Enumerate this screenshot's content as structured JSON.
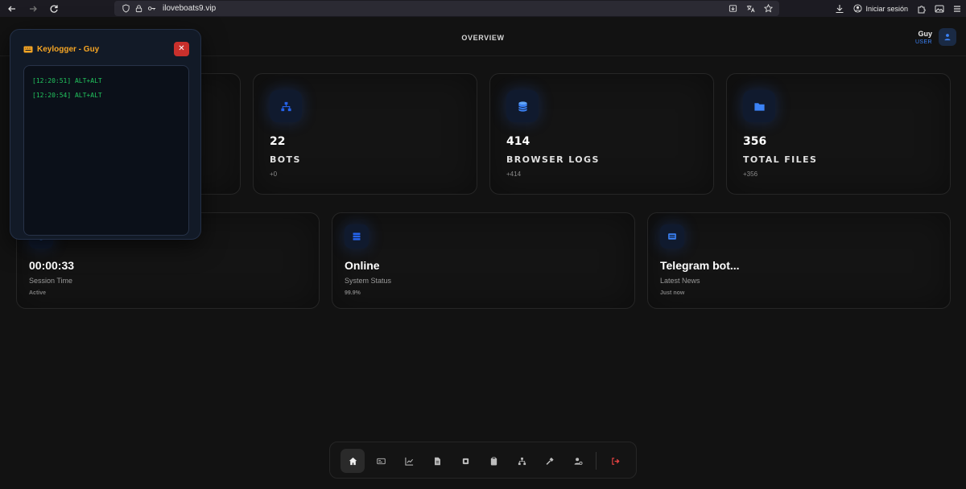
{
  "browser": {
    "url": "iloveboats9.vip",
    "signin_label": "Iniciar sesión"
  },
  "header": {
    "title": "OVERVIEW",
    "user_name": "Guy",
    "user_role": "USER"
  },
  "stats": [
    {
      "value": "22",
      "label": "BOTS",
      "delta": "+0",
      "icon": "network-icon"
    },
    {
      "value": "414",
      "label": "BROWSER LOGS",
      "delta": "+414",
      "icon": "database-icon"
    },
    {
      "value": "356",
      "label": "TOTAL FILES",
      "delta": "+356",
      "icon": "folder-icon"
    }
  ],
  "info": [
    {
      "value": "00:00:33",
      "label": "Session Time",
      "sub": "Active",
      "icon": "clock-icon"
    },
    {
      "value": "Online",
      "label": "System Status",
      "sub": "99.9%",
      "icon": "server-icon"
    },
    {
      "value": "Telegram bot...",
      "label": "Latest News",
      "sub": "Just now",
      "icon": "news-icon"
    }
  ],
  "keylogger": {
    "title": "Keylogger - Guy",
    "close_label": "✕",
    "lines": [
      "[12:20:51] ALT+ALT",
      "[12:20:54] ALT+ALT"
    ]
  },
  "dock": {
    "items": [
      "home-icon",
      "id-card-icon",
      "chart-icon",
      "file-icon",
      "chip-icon",
      "clipboard-icon",
      "network-icon",
      "hammer-icon",
      "user-settings-icon",
      "logout-icon"
    ]
  },
  "colors": {
    "accent": "#3b82f6",
    "keylogger_title": "#f5a524",
    "log_text": "#22c55e",
    "close": "#c9302c",
    "logout": "#ef4444"
  }
}
